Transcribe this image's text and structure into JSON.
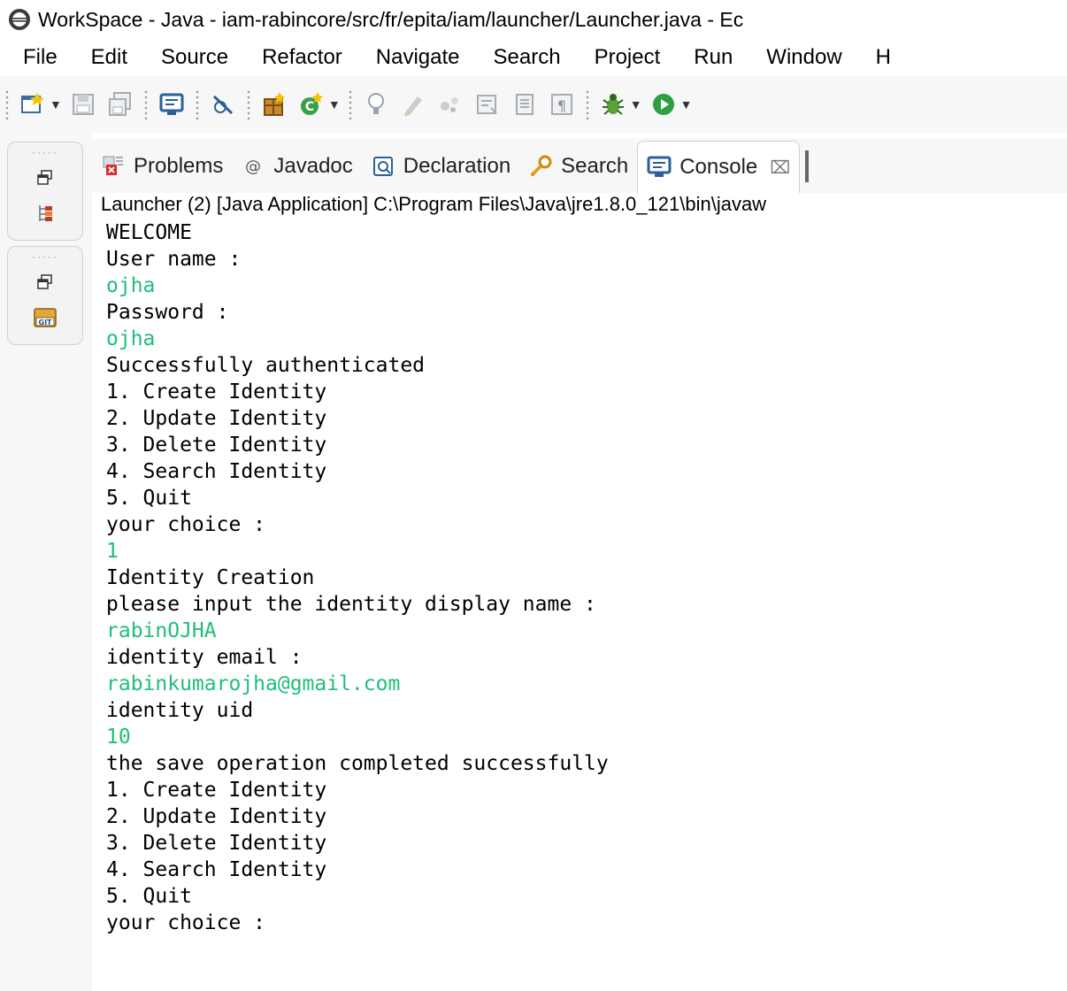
{
  "window": {
    "title": "WorkSpace - Java - iam-rabincore/src/fr/epita/iam/launcher/Launcher.java - Ec"
  },
  "menu": [
    "File",
    "Edit",
    "Source",
    "Refactor",
    "Navigate",
    "Search",
    "Project",
    "Run",
    "Window",
    "H"
  ],
  "toolbar": {
    "icons": [
      "new-wizard-icon",
      "save-icon",
      "save-all-icon",
      "open-console-icon",
      "skip-breakpoints-icon",
      "new-java-package-icon",
      "new-java-class-icon",
      "toggle-breakpoint-icon",
      "toggle-mark-occurrences-icon",
      "word-wrap-icon",
      "show-whitespace-icon",
      "debug-icon",
      "run-icon"
    ]
  },
  "view": {
    "tabs": [
      {
        "label": "Problems",
        "icon": "problems-icon"
      },
      {
        "label": "Javadoc",
        "icon": "javadoc-icon"
      },
      {
        "label": "Declaration",
        "icon": "declaration-icon"
      },
      {
        "label": "Search",
        "icon": "search-icon"
      },
      {
        "label": "Console",
        "icon": "console-icon",
        "active": true,
        "close": "⌧"
      }
    ],
    "launch_description": "Launcher (2) [Java Application] C:\\Program Files\\Java\\jre1.8.0_121\\bin\\javaw"
  },
  "console": {
    "input_color": "#1fbf7a",
    "lines": [
      {
        "text": "WELCOME",
        "type": "out"
      },
      {
        "text": "User name :",
        "type": "out"
      },
      {
        "text": "ojha",
        "type": "in"
      },
      {
        "text": "Password :",
        "type": "out"
      },
      {
        "text": "ojha",
        "type": "in"
      },
      {
        "text": "Successfully authenticated",
        "type": "out"
      },
      {
        "text": "1. Create Identity",
        "type": "out"
      },
      {
        "text": "2. Update Identity",
        "type": "out"
      },
      {
        "text": "3. Delete Identity",
        "type": "out"
      },
      {
        "text": "4. Search Identity",
        "type": "out"
      },
      {
        "text": "5. Quit",
        "type": "out"
      },
      {
        "text": "your choice :",
        "type": "out"
      },
      {
        "text": "1",
        "type": "in"
      },
      {
        "text": "Identity Creation",
        "type": "out"
      },
      {
        "text": "please input the identity display name :",
        "type": "out"
      },
      {
        "text": "rabinOJHA",
        "type": "in"
      },
      {
        "text": "identity email :",
        "type": "out"
      },
      {
        "text": "rabinkumarojha@gmail.com",
        "type": "in"
      },
      {
        "text": "identity uid",
        "type": "out"
      },
      {
        "text": "10",
        "type": "in"
      },
      {
        "text": "the save operation completed successfully",
        "type": "out"
      },
      {
        "text": "1. Create Identity",
        "type": "out"
      },
      {
        "text": "2. Update Identity",
        "type": "out"
      },
      {
        "text": "3. Delete Identity",
        "type": "out"
      },
      {
        "text": "4. Search Identity",
        "type": "out"
      },
      {
        "text": "5. Quit",
        "type": "out"
      },
      {
        "text": "your choice :",
        "type": "out"
      }
    ]
  }
}
